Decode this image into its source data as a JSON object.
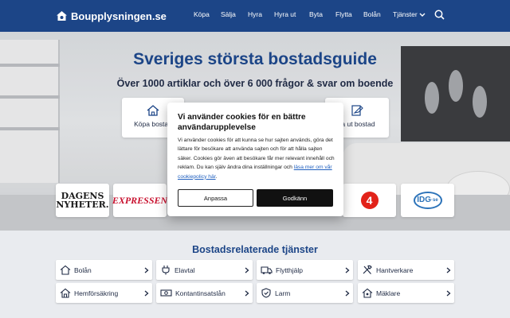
{
  "header": {
    "logo_text": "Boupplysningen.se",
    "nav": [
      "Köpa",
      "Sälja",
      "Hyra",
      "Hyra ut",
      "Byta",
      "Flytta",
      "Bolån",
      "Tjänster"
    ]
  },
  "hero": {
    "title": "Sveriges största bostadsguide",
    "subtitle": "Över 1000 artiklar och över 6 000 frågor & svar om boende",
    "cards": [
      {
        "label": "Köpa bostad",
        "icon": "house-icon"
      },
      {
        "label": "ra ut bostad",
        "icon": "sign-contract-icon"
      }
    ],
    "press": {
      "dn_line1": "DAGENS",
      "dn_line2": "NYHETER.",
      "expressen": "EXPRESSEN",
      "tv4": "4",
      "idg": "IDG",
      "idg_sub": "·se"
    }
  },
  "cookie": {
    "title": "Vi använder cookies för en bättre användarupplevelse",
    "body": "Vi använder cookies för att kunna se hur sajten används, göra det lättare för besökare att använda sajten och för att hålla sajten säker. Cookies gör även att besökare får mer relevant innehåll och reklam. Du kan själv ändra dina inställningar och",
    "link": "läsa mer om vår cookiepolicy här",
    "link_suffix": ".",
    "btn_adjust": "Anpassa",
    "btn_accept": "Godkänn"
  },
  "services": {
    "title": "Bostadsrelaterade tjänster",
    "items": [
      {
        "label": "Bolån",
        "icon": "house-icon"
      },
      {
        "label": "Elavtal",
        "icon": "plug-icon"
      },
      {
        "label": "Flytthjälp",
        "icon": "truck-icon"
      },
      {
        "label": "Hantverkare",
        "icon": "tools-icon"
      },
      {
        "label": "Hemförsäkring",
        "icon": "house-icon"
      },
      {
        "label": "Kontantinsatslån",
        "icon": "money-icon"
      },
      {
        "label": "Larm",
        "icon": "shield-icon"
      },
      {
        "label": "Mäklare",
        "icon": "house-key-icon"
      }
    ]
  },
  "colors": {
    "brand": "#1c4587",
    "accept": "#111111",
    "link": "#1f5fbf"
  }
}
